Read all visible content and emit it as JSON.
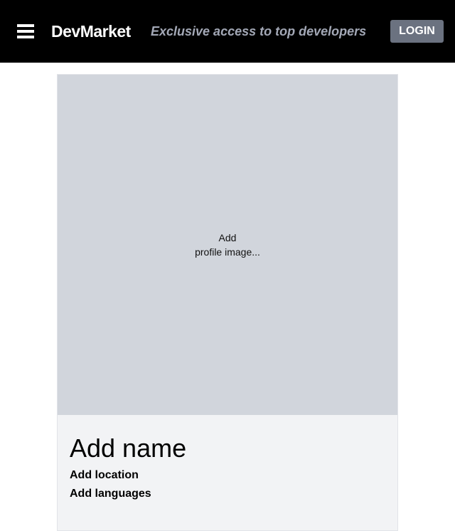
{
  "header": {
    "menu_icon": "hamburger-menu-icon",
    "logo": "DevMarket",
    "tagline": "Exclusive access to top developers",
    "login_label": "LOGIN",
    "background_color": "#000000",
    "login_button_color": "#6b7280"
  },
  "profile": {
    "image_prompt_line1": "Add",
    "image_prompt_line2": "profile image...",
    "name_placeholder": "Add name",
    "location_placeholder": "Add location",
    "languages_placeholder": "Add languages",
    "image_background_color": "#d1d5dc",
    "card_background_color": "#f2f3f5"
  }
}
